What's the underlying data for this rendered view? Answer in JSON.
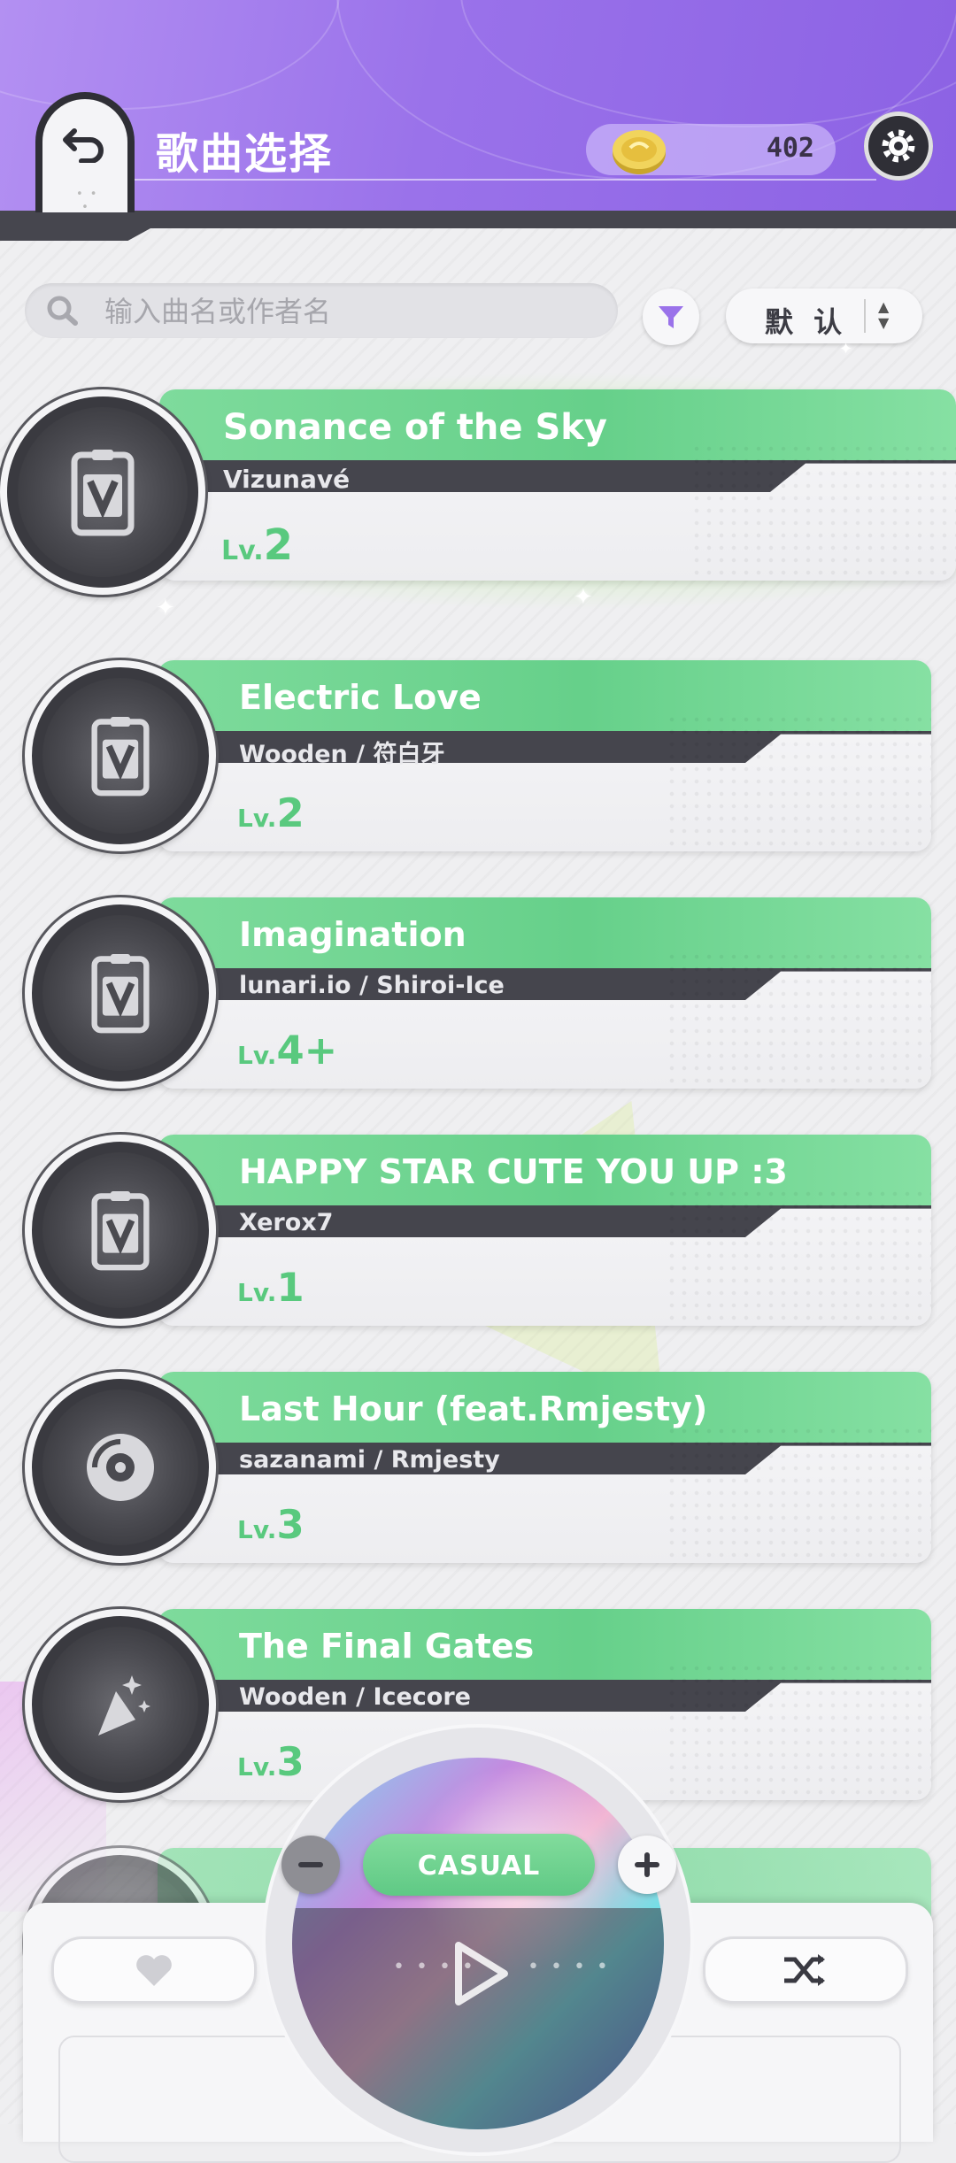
{
  "header": {
    "title": "歌曲选择",
    "coins": "402",
    "colors": {
      "header_bg": "#9a72ea",
      "accent_green": "#66d08a",
      "level_green": "#59c97e"
    }
  },
  "search": {
    "placeholder": "输入曲名或作者名",
    "sort_label": "默 认"
  },
  "songs": [
    {
      "title": "Sonance of the Sky",
      "artist": "Vizunavé",
      "lv_prefix": "Lv.",
      "lv": "2",
      "icon": "voucher-icon",
      "selected": true
    },
    {
      "title": "Electric Love",
      "artist": "Wooden / 符白牙",
      "lv_prefix": "Lv.",
      "lv": "2",
      "icon": "voucher-icon"
    },
    {
      "title": "Imagination",
      "artist": "lunari.io / Shiroi-Ice",
      "lv_prefix": "Lv.",
      "lv": "4+",
      "icon": "voucher-icon"
    },
    {
      "title": "HAPPY STAR CUTE YOU UP :3",
      "artist": "Xerox7",
      "lv_prefix": "Lv.",
      "lv": "1",
      "icon": "voucher-icon"
    },
    {
      "title": "Last Hour (feat.Rmjesty)",
      "artist": "sazanami / Rmjesty",
      "lv_prefix": "Lv.",
      "lv": "3",
      "icon": "disc-icon"
    },
    {
      "title": "The Final Gates",
      "artist": "Wooden / Icecore",
      "lv_prefix": "Lv.",
      "lv": "3",
      "icon": "party-popper-icon"
    }
  ],
  "player": {
    "difficulty": "CASUAL"
  }
}
